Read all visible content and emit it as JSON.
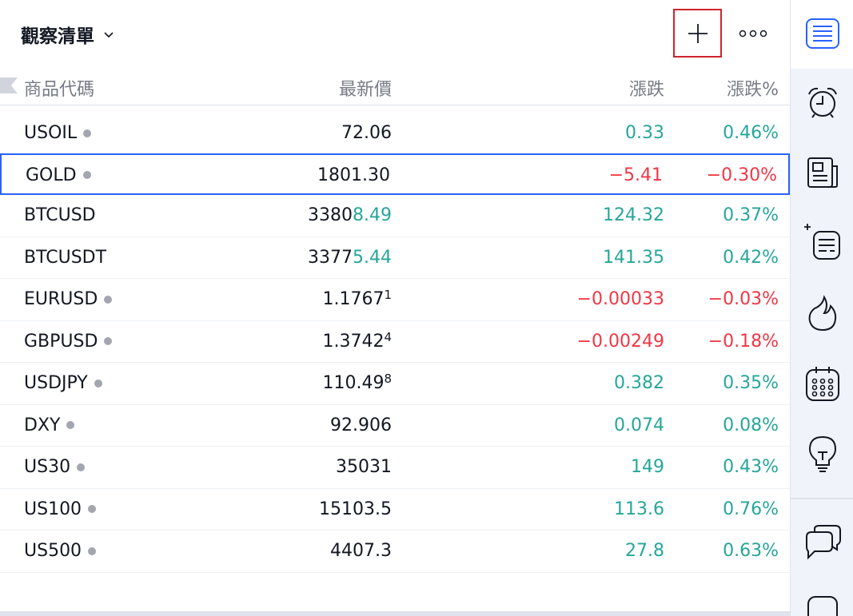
{
  "header": {
    "title": "觀察清單",
    "add_icon": "plus-icon",
    "more_icon": "more-horizontal-icon"
  },
  "columns": {
    "symbol": "商品代碼",
    "last": "最新價",
    "change": "漲跌",
    "change_pct": "漲跌%"
  },
  "rows": [
    {
      "symbol": "USOIL",
      "dot": true,
      "last_main": "72.06",
      "last_hi": "",
      "last_sup": "",
      "change": "0.33",
      "change_pct": "0.46%",
      "dir": "pos"
    },
    {
      "symbol": "GOLD",
      "dot": true,
      "last_main": "1801.30",
      "last_hi": "",
      "last_sup": "",
      "change": "−5.41",
      "change_pct": "−0.30%",
      "dir": "neg",
      "selected": true
    },
    {
      "symbol": "BTCUSD",
      "dot": false,
      "last_main": "3380",
      "last_hi": "8.49",
      "last_sup": "",
      "change": "124.32",
      "change_pct": "0.37%",
      "dir": "pos"
    },
    {
      "symbol": "BTCUSDT",
      "dot": false,
      "last_main": "3377",
      "last_hi": "5.44",
      "last_sup": "",
      "change": "141.35",
      "change_pct": "0.42%",
      "dir": "pos"
    },
    {
      "symbol": "EURUSD",
      "dot": true,
      "last_main": "1.1767",
      "last_hi": "",
      "last_sup": "1",
      "change": "−0.00033",
      "change_pct": "−0.03%",
      "dir": "neg"
    },
    {
      "symbol": "GBPUSD",
      "dot": true,
      "last_main": "1.3742",
      "last_hi": "",
      "last_sup": "4",
      "change": "−0.00249",
      "change_pct": "−0.18%",
      "dir": "neg"
    },
    {
      "symbol": "USDJPY",
      "dot": true,
      "last_main": "110.49",
      "last_hi": "",
      "last_sup": "8",
      "change": "0.382",
      "change_pct": "0.35%",
      "dir": "pos"
    },
    {
      "symbol": "DXY",
      "dot": true,
      "last_main": "92.906",
      "last_hi": "",
      "last_sup": "",
      "change": "0.074",
      "change_pct": "0.08%",
      "dir": "pos"
    },
    {
      "symbol": "US30",
      "dot": true,
      "last_main": "35031",
      "last_hi": "",
      "last_sup": "",
      "change": "149",
      "change_pct": "0.43%",
      "dir": "pos"
    },
    {
      "symbol": "US100",
      "dot": true,
      "last_main": "15103.5",
      "last_hi": "",
      "last_sup": "",
      "change": "113.6",
      "change_pct": "0.76%",
      "dir": "pos"
    },
    {
      "symbol": "US500",
      "dot": true,
      "last_main": "4407.3",
      "last_hi": "",
      "last_sup": "",
      "change": "27.8",
      "change_pct": "0.63%",
      "dir": "pos"
    }
  ],
  "sidebar": {
    "items": [
      {
        "name": "watchlist-icon"
      },
      {
        "name": "alarm-clock-icon"
      },
      {
        "name": "news-icon"
      },
      {
        "name": "hotlists-icon"
      },
      {
        "name": "fire-icon"
      },
      {
        "name": "calendar-icon"
      },
      {
        "name": "lightbulb-icon"
      },
      {
        "name": "chat-icon"
      },
      {
        "name": "message-icon"
      }
    ]
  },
  "colors": {
    "positive": "#26a69a",
    "negative": "#f23645",
    "accent": "#2962ff",
    "highlight_border": "#d0232b"
  }
}
